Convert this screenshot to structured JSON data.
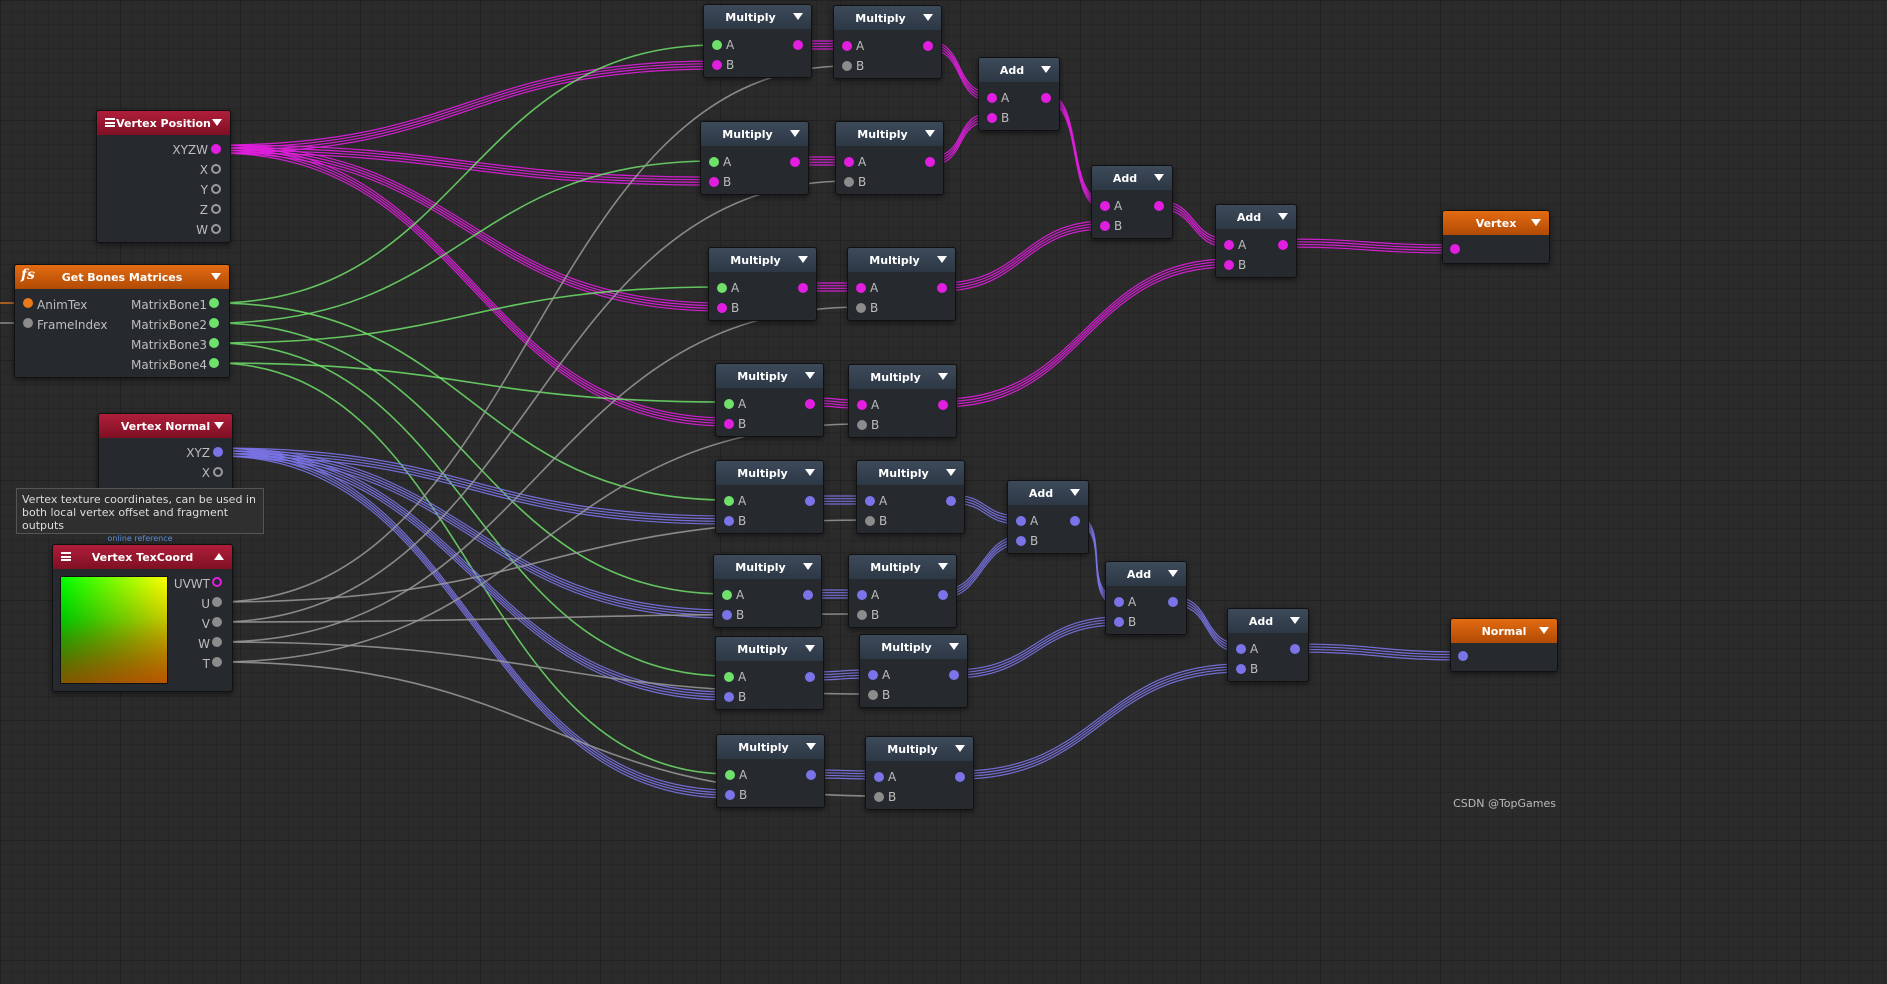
{
  "colors": {
    "float4": "#e21ee0",
    "float3": "#7b74e8",
    "matrix": "#6fe06a",
    "float": "#8c8c8c",
    "sampler": "#e87a1a"
  },
  "nodes": {
    "vertex_position": {
      "title": "Vertex Position",
      "outputs": [
        "XYZW",
        "X",
        "Y",
        "Z",
        "W"
      ]
    },
    "get_bones": {
      "title": "Get Bones Matrices",
      "inputs": [
        "AnimTex",
        "FrameIndex"
      ],
      "outputs": [
        "MatrixBone1",
        "MatrixBone2",
        "MatrixBone3",
        "MatrixBone4"
      ]
    },
    "vertex_normal": {
      "title": "Vertex Normal",
      "outputs": [
        "XYZ",
        "X"
      ]
    },
    "vertex_texcoord": {
      "title": "Vertex TexCoord",
      "outputs": [
        "UVWT",
        "U",
        "V",
        "W",
        "T"
      ]
    },
    "vertex_out": {
      "title": "Vertex"
    },
    "normal_out": {
      "title": "Normal"
    }
  },
  "labels": {
    "multiply": "Multiply",
    "add": "Add",
    "a": "A",
    "b": "B"
  },
  "tooltip": {
    "text": "Vertex texture coordinates, can be used in both local vertex offset and fragment outputs",
    "link": "online reference"
  },
  "watermark": "CSDN @TopGames"
}
